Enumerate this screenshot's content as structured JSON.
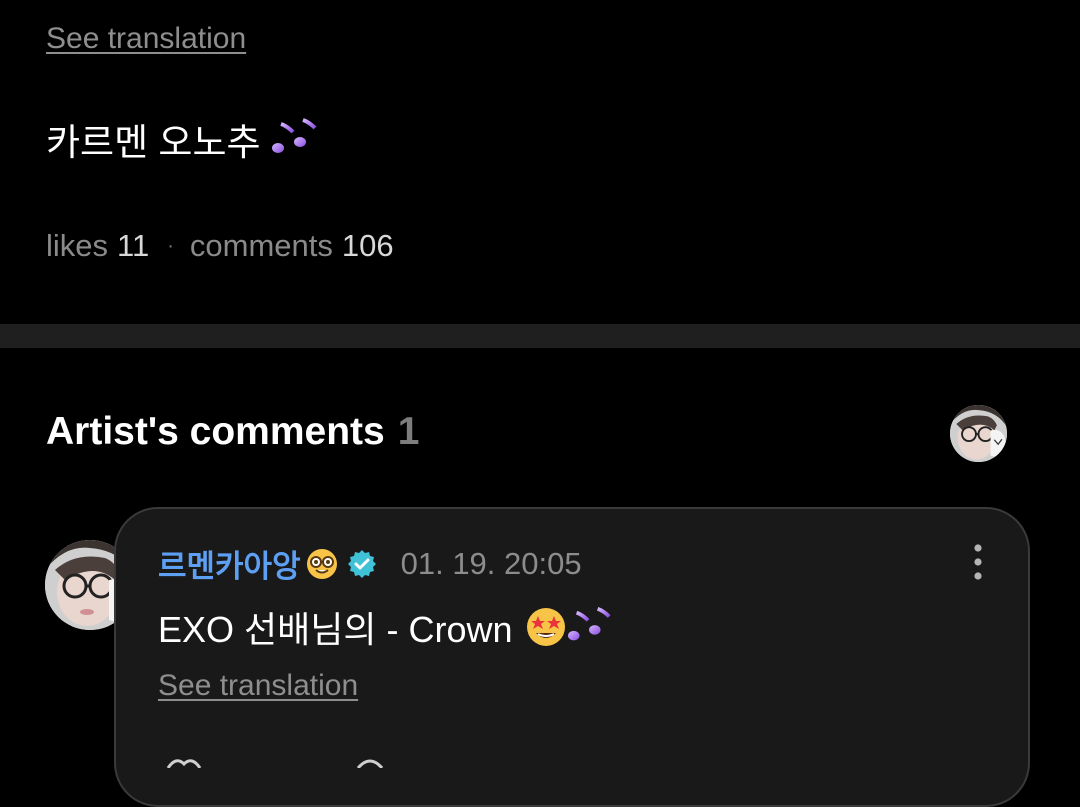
{
  "post": {
    "see_translation": "See translation",
    "text": "카르멘 오노추",
    "notes_emoji": "🎶",
    "stats": {
      "likes_label": "likes",
      "likes_count": "11",
      "separator": "·",
      "comments_label": "comments",
      "comments_count": "106"
    }
  },
  "artist_comments": {
    "heading": "Artist's comments",
    "count": "1"
  },
  "comment": {
    "author": "르멘카아앙",
    "author_emoji": "🤓",
    "time": "01. 19. 20:05",
    "text": "EXO 선배님의 - Crown",
    "emoji": "🤩🎶",
    "see_translation": "See translation"
  },
  "colors": {
    "background": "#000000",
    "card": "#191919",
    "author_blue": "#5d9ff2",
    "verified_teal": "#3fc1d6",
    "muted": "#8e8e8e"
  },
  "icons": {
    "verified": "verified-badge-icon",
    "more": "more-vertical-icon",
    "notes": "music-notes-icon",
    "nerd": "nerd-face-icon",
    "star_eyes": "star-struck-icon"
  }
}
